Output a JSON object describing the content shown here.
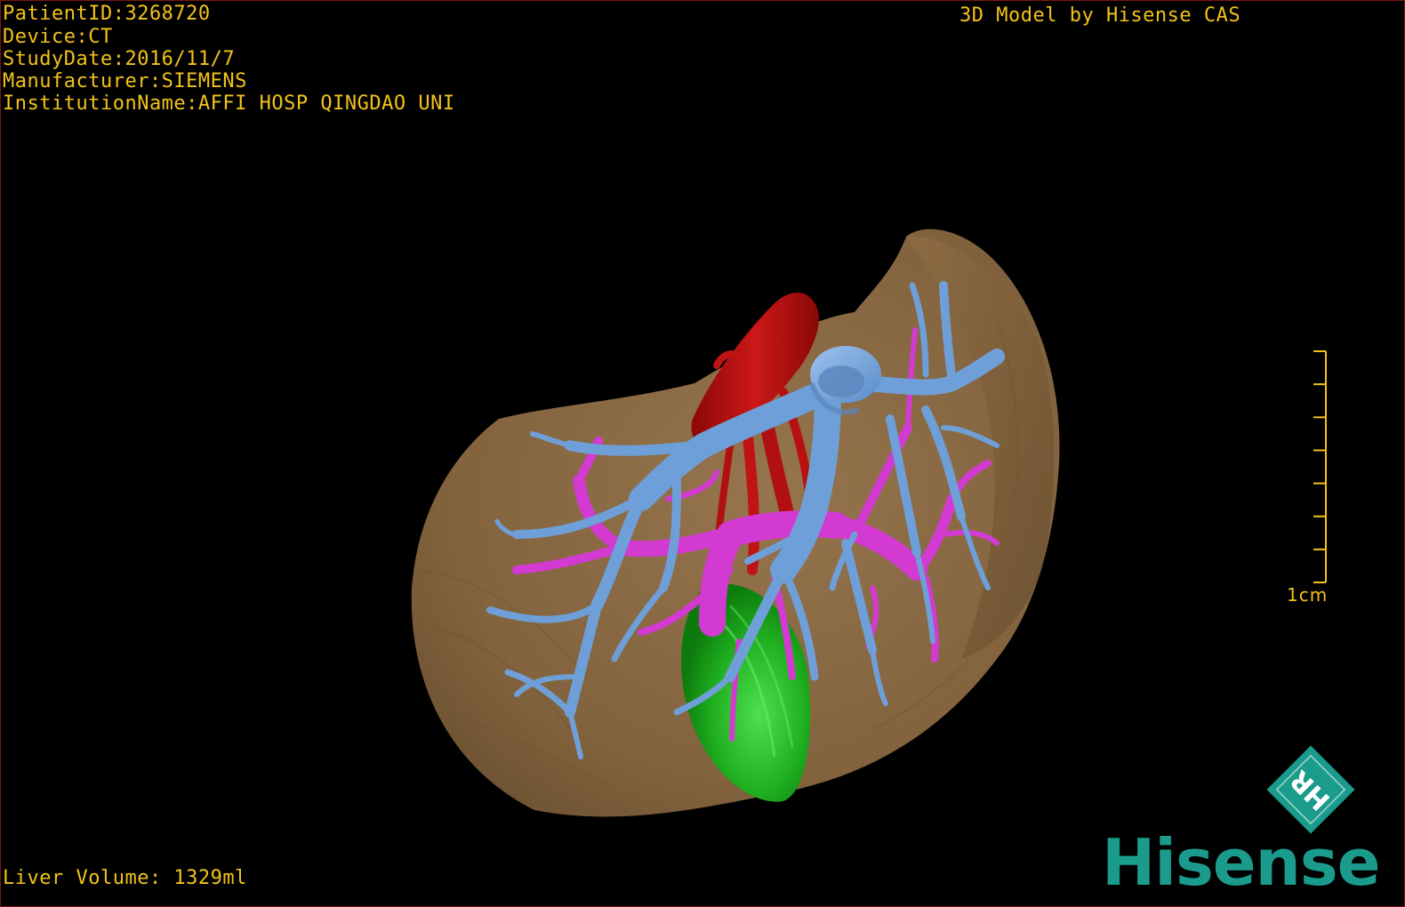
{
  "overlay": {
    "patient_id": "PatientID:3268720",
    "device": "Device:CT",
    "study_date": "StudyDate:2016/11/7",
    "manufacturer": "Manufacturer:SIEMENS",
    "institution": "InstitutionName:AFFI HOSP QINGDAO UNI",
    "credit": "3D Model by Hisense CAS",
    "liver_volume": "Liver Volume: 1329ml"
  },
  "scale_bar": {
    "label": "1cm",
    "tick_count": 8
  },
  "branding": {
    "badge_text": "HR",
    "logo_text": "Hisense"
  },
  "model": {
    "structures": [
      "liver",
      "hepatic-veins",
      "portal-vein",
      "hepatic-artery",
      "gallbladder"
    ]
  },
  "colors": {
    "text_overlay": "#f2c21a",
    "liver": "#8a6a44",
    "hepatic_vein": "#6f9fd8",
    "portal_vein": "#d33ad2",
    "artery": "#b81010",
    "gallbladder": "#1fae1f",
    "brand": "#1a9b8c",
    "border": "#7a1414"
  }
}
